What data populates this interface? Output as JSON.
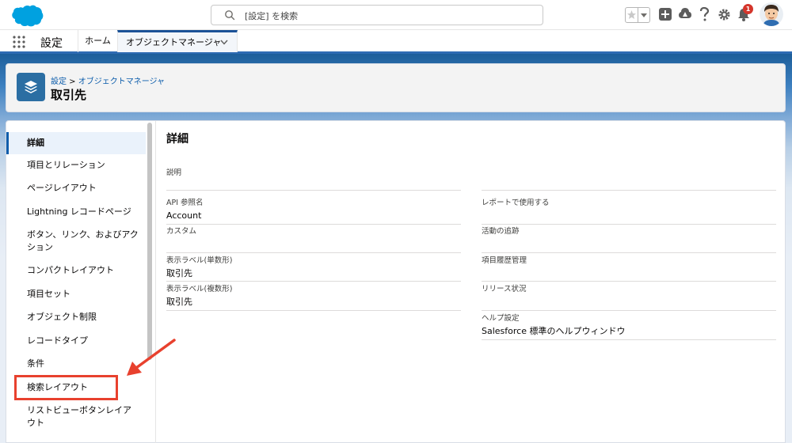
{
  "header": {
    "search_placeholder": "[設定] を検索",
    "notification_count": "1",
    "brand_color": "#00a1e0",
    "icons": [
      "salesforce-cloud-logo",
      "search-icon",
      "star-icon",
      "chevron-down-icon",
      "plus-icon",
      "trailhead-icon",
      "help-icon",
      "gear-icon",
      "bell-icon",
      "avatar"
    ]
  },
  "nav": {
    "app_name": "設定",
    "tabs": [
      {
        "label": "ホーム"
      },
      {
        "label": "オブジェクトマネージャ"
      }
    ]
  },
  "page_header": {
    "breadcrumb_root": "設定",
    "breadcrumb_sep": " > ",
    "breadcrumb_current": "オブジェクトマネージャ",
    "title": "取引先"
  },
  "sidebar": {
    "items": [
      {
        "label": "詳細"
      },
      {
        "label": "項目とリレーション"
      },
      {
        "label": "ページレイアウト"
      },
      {
        "label": "Lightning レコードページ"
      },
      {
        "label": "ボタン、リンク、およびアク"
      },
      {
        "label": "ション"
      },
      {
        "label": "コンパクトレイアウト"
      },
      {
        "label": "項目セット"
      },
      {
        "label": "オブジェクト制限"
      },
      {
        "label": "レコードタイプ"
      },
      {
        "label": "条件"
      },
      {
        "label": "検索レイアウト"
      },
      {
        "label": "リストビューボタンレイア"
      },
      {
        "label": "ウト"
      }
    ]
  },
  "details": {
    "title": "詳細",
    "left": [
      {
        "label": "説明",
        "value": ""
      },
      {
        "label": "API 参照名",
        "value": "Account"
      },
      {
        "label": "カスタム",
        "value": ""
      },
      {
        "label": "表示ラベル(単数形)",
        "value": "取引先"
      },
      {
        "label": "表示ラベル(複数形)",
        "value": "取引先"
      }
    ],
    "right": [
      {
        "label": "レポートで使用する",
        "value": ""
      },
      {
        "label": "活動の追跡",
        "value": ""
      },
      {
        "label": "項目履歴管理",
        "value": ""
      },
      {
        "label": "リリース状況",
        "value": ""
      },
      {
        "label": "ヘルプ設定",
        "value": "Salesforce 標準のヘルプウィンドウ"
      }
    ]
  },
  "annotation": {
    "color": "#e8412e",
    "target": "検索レイアウト"
  }
}
